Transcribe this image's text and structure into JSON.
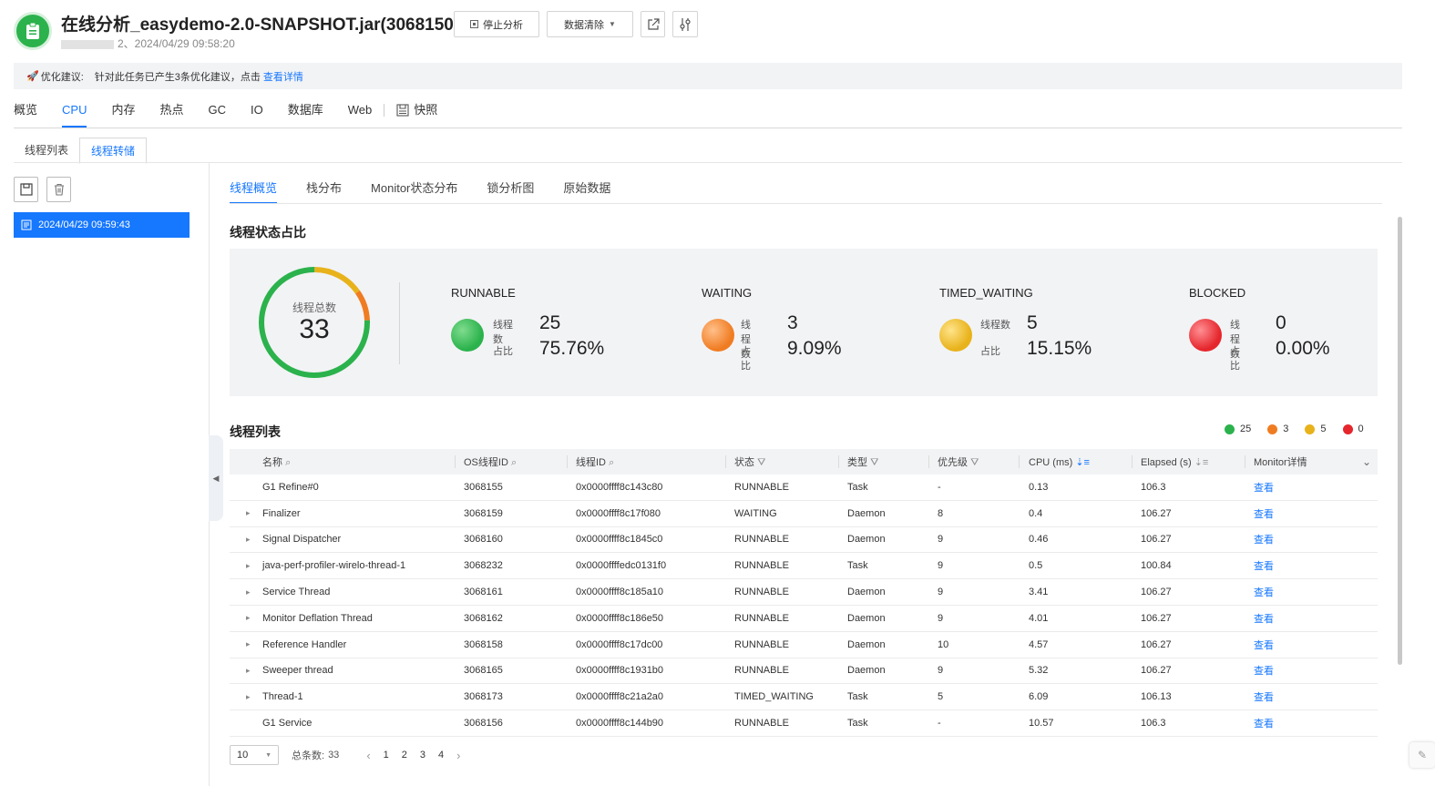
{
  "header": {
    "title": "在线分析_easydemo-2.0-SNAPSHOT.jar(3068150)",
    "subtitle_suffix": "2、2024/04/29 09:58:20",
    "stop_label": "停止分析",
    "clear_label": "数据清除"
  },
  "tip": {
    "prefix": "优化建议:",
    "text": "针对此任务已产生3条优化建议，点击",
    "link": "查看详情"
  },
  "main_tabs": [
    "概览",
    "CPU",
    "内存",
    "热点",
    "GC",
    "IO",
    "数据库",
    "Web"
  ],
  "main_tab_active": "CPU",
  "snapshot_tab": "快照",
  "sub_tabs": [
    "线程列表",
    "线程转储"
  ],
  "sub_tab_active": "线程转储",
  "snapshot_item": "2024/04/29 09:59:43",
  "inner_tabs": [
    "线程概览",
    "栈分布",
    "Monitor状态分布",
    "锁分析图",
    "原始数据"
  ],
  "inner_tab_active": "线程概览",
  "state_section": {
    "title": "线程状态占比",
    "total_label": "线程总数",
    "total": "33",
    "count_label": "线程数",
    "ratio_label": "占比",
    "states": [
      {
        "name": "RUNNABLE",
        "count": "25",
        "ratio": "75.76%",
        "color": "#2bb24c"
      },
      {
        "name": "WAITING",
        "count": "3",
        "ratio": "9.09%",
        "color": "#f07c22"
      },
      {
        "name": "TIMED_WAITING",
        "count": "5",
        "ratio": "15.15%",
        "color": "#e8b21a"
      },
      {
        "name": "BLOCKED",
        "count": "0",
        "ratio": "0.00%",
        "color": "#e5262c"
      }
    ]
  },
  "list_section": {
    "title": "线程列表",
    "legend": [
      {
        "value": "25",
        "color": "#2bb24c"
      },
      {
        "value": "3",
        "color": "#f07c22"
      },
      {
        "value": "5",
        "color": "#e8b21a"
      },
      {
        "value": "0",
        "color": "#e5262c"
      }
    ],
    "columns": [
      "名称",
      "OS线程ID",
      "线程ID",
      "状态",
      "类型",
      "优先级",
      "CPU (ms)",
      "Elapsed (s)",
      "Monitor详情"
    ],
    "view_label": "查看",
    "rows": [
      {
        "name": "G1 Refine#0",
        "expand": false,
        "os_id": "3068155",
        "tid": "0x0000ffff8c143c80",
        "state": "RUNNABLE",
        "type": "Task",
        "priority": "-",
        "cpu": "0.13",
        "elapsed": "106.3"
      },
      {
        "name": "Finalizer",
        "expand": true,
        "os_id": "3068159",
        "tid": "0x0000ffff8c17f080",
        "state": "WAITING",
        "type": "Daemon",
        "priority": "8",
        "cpu": "0.4",
        "elapsed": "106.27"
      },
      {
        "name": "Signal Dispatcher",
        "expand": true,
        "os_id": "3068160",
        "tid": "0x0000ffff8c1845c0",
        "state": "RUNNABLE",
        "type": "Daemon",
        "priority": "9",
        "cpu": "0.46",
        "elapsed": "106.27"
      },
      {
        "name": "java-perf-profiler-wirelo-thread-1",
        "expand": true,
        "os_id": "3068232",
        "tid": "0x0000ffffedc0131f0",
        "state": "RUNNABLE",
        "type": "Task",
        "priority": "9",
        "cpu": "0.5",
        "elapsed": "100.84"
      },
      {
        "name": "Service Thread",
        "expand": true,
        "os_id": "3068161",
        "tid": "0x0000ffff8c185a10",
        "state": "RUNNABLE",
        "type": "Daemon",
        "priority": "9",
        "cpu": "3.41",
        "elapsed": "106.27"
      },
      {
        "name": "Monitor Deflation Thread",
        "expand": true,
        "os_id": "3068162",
        "tid": "0x0000ffff8c186e50",
        "state": "RUNNABLE",
        "type": "Daemon",
        "priority": "9",
        "cpu": "4.01",
        "elapsed": "106.27"
      },
      {
        "name": "Reference Handler",
        "expand": true,
        "os_id": "3068158",
        "tid": "0x0000ffff8c17dc00",
        "state": "RUNNABLE",
        "type": "Daemon",
        "priority": "10",
        "cpu": "4.57",
        "elapsed": "106.27"
      },
      {
        "name": "Sweeper thread",
        "expand": true,
        "os_id": "3068165",
        "tid": "0x0000ffff8c1931b0",
        "state": "RUNNABLE",
        "type": "Daemon",
        "priority": "9",
        "cpu": "5.32",
        "elapsed": "106.27"
      },
      {
        "name": "Thread-1",
        "expand": true,
        "os_id": "3068173",
        "tid": "0x0000ffff8c21a2a0",
        "state": "TIMED_WAITING",
        "type": "Task",
        "priority": "5",
        "cpu": "6.09",
        "elapsed": "106.13"
      },
      {
        "name": "G1 Service",
        "expand": false,
        "os_id": "3068156",
        "tid": "0x0000ffff8c144b90",
        "state": "RUNNABLE",
        "type": "Task",
        "priority": "-",
        "cpu": "10.57",
        "elapsed": "106.3"
      }
    ]
  },
  "pagination": {
    "page_size": "10",
    "total_label": "总条数:",
    "total": "33",
    "pages": [
      "1",
      "2",
      "3",
      "4"
    ]
  }
}
